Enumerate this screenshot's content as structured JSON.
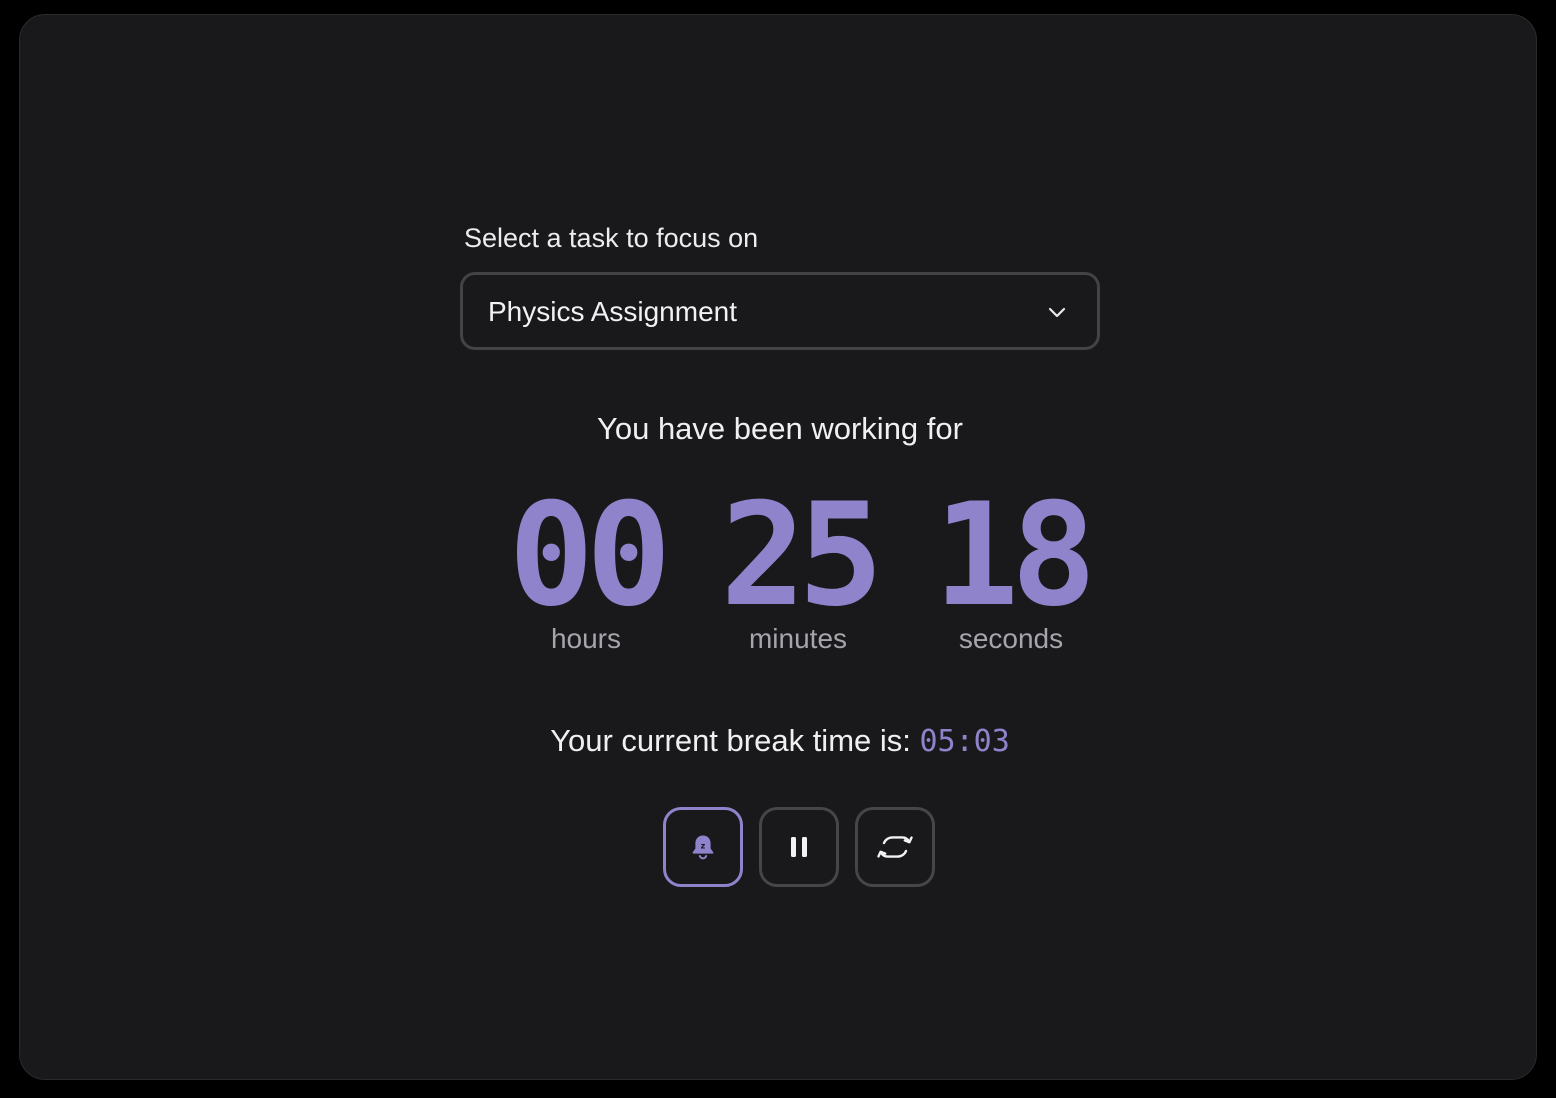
{
  "task_selector": {
    "label": "Select a task to focus on",
    "selected_value": "Physics Assignment",
    "icon": "chevron-down-icon"
  },
  "working": {
    "label": "You have been working for",
    "hours": "00",
    "hours_label": "hours",
    "minutes": "25",
    "minutes_label": "minutes",
    "seconds": "18",
    "seconds_label": "seconds"
  },
  "break": {
    "label": "Your current break time is:",
    "value": "05:03"
  },
  "controls": [
    {
      "icon": "bell-snooze-icon",
      "active": true
    },
    {
      "icon": "pause-icon",
      "active": false
    },
    {
      "icon": "reset-icon",
      "active": false
    }
  ],
  "colors": {
    "background": "#19191b",
    "accent": "#8f83cc",
    "text": "#f0f0f3",
    "muted": "#a5a5ab",
    "border": "#45454a"
  }
}
